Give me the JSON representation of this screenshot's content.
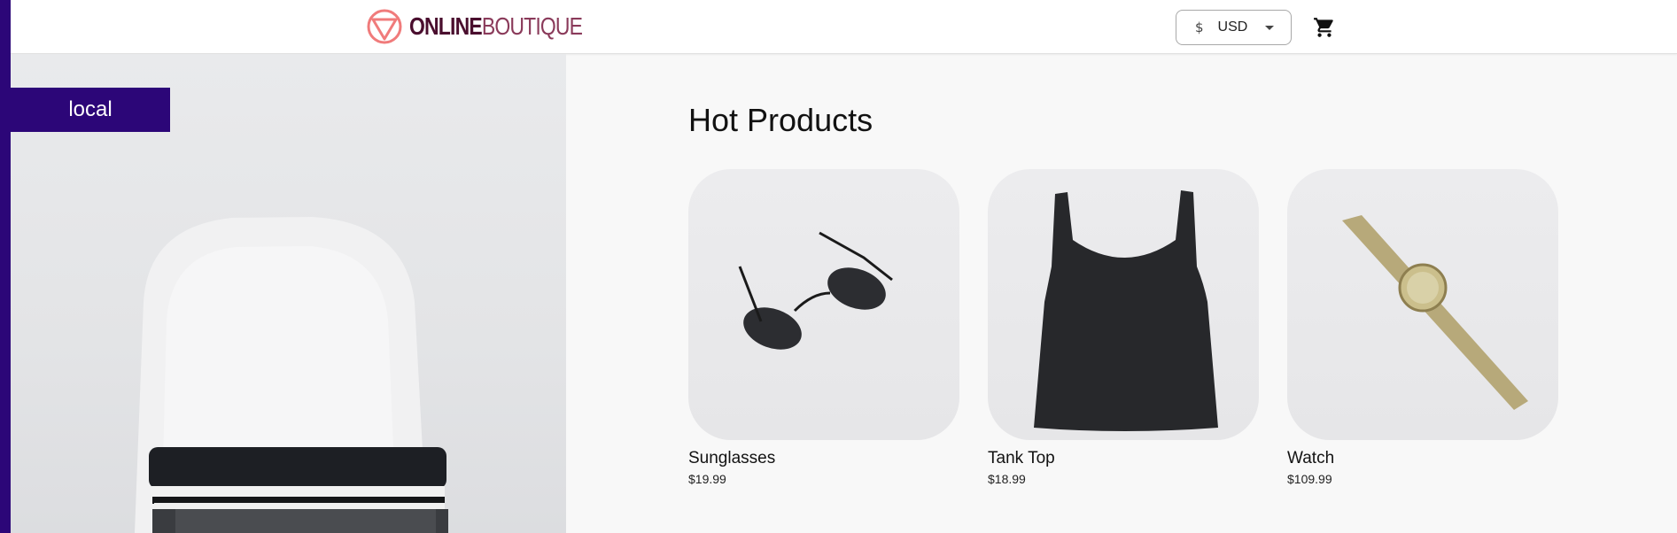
{
  "header": {
    "logo": {
      "part1": "ONLINE",
      "part2": "BOUTIQUE"
    },
    "currency": {
      "symbol": "$",
      "code": "USD"
    },
    "cart_icon": "shopping-cart-icon"
  },
  "hero": {
    "env_label": "local"
  },
  "main": {
    "section_title": "Hot Products",
    "products": [
      {
        "name": "Sunglasses",
        "price": "$19.99",
        "image": "sunglasses"
      },
      {
        "name": "Tank Top",
        "price": "$18.99",
        "image": "tank-top"
      },
      {
        "name": "Watch",
        "price": "$109.99",
        "image": "watch"
      }
    ]
  },
  "colors": {
    "accent": "#2c0678",
    "logo_primary": "#4a0e2e",
    "logo_mark": "#f07b7b"
  }
}
